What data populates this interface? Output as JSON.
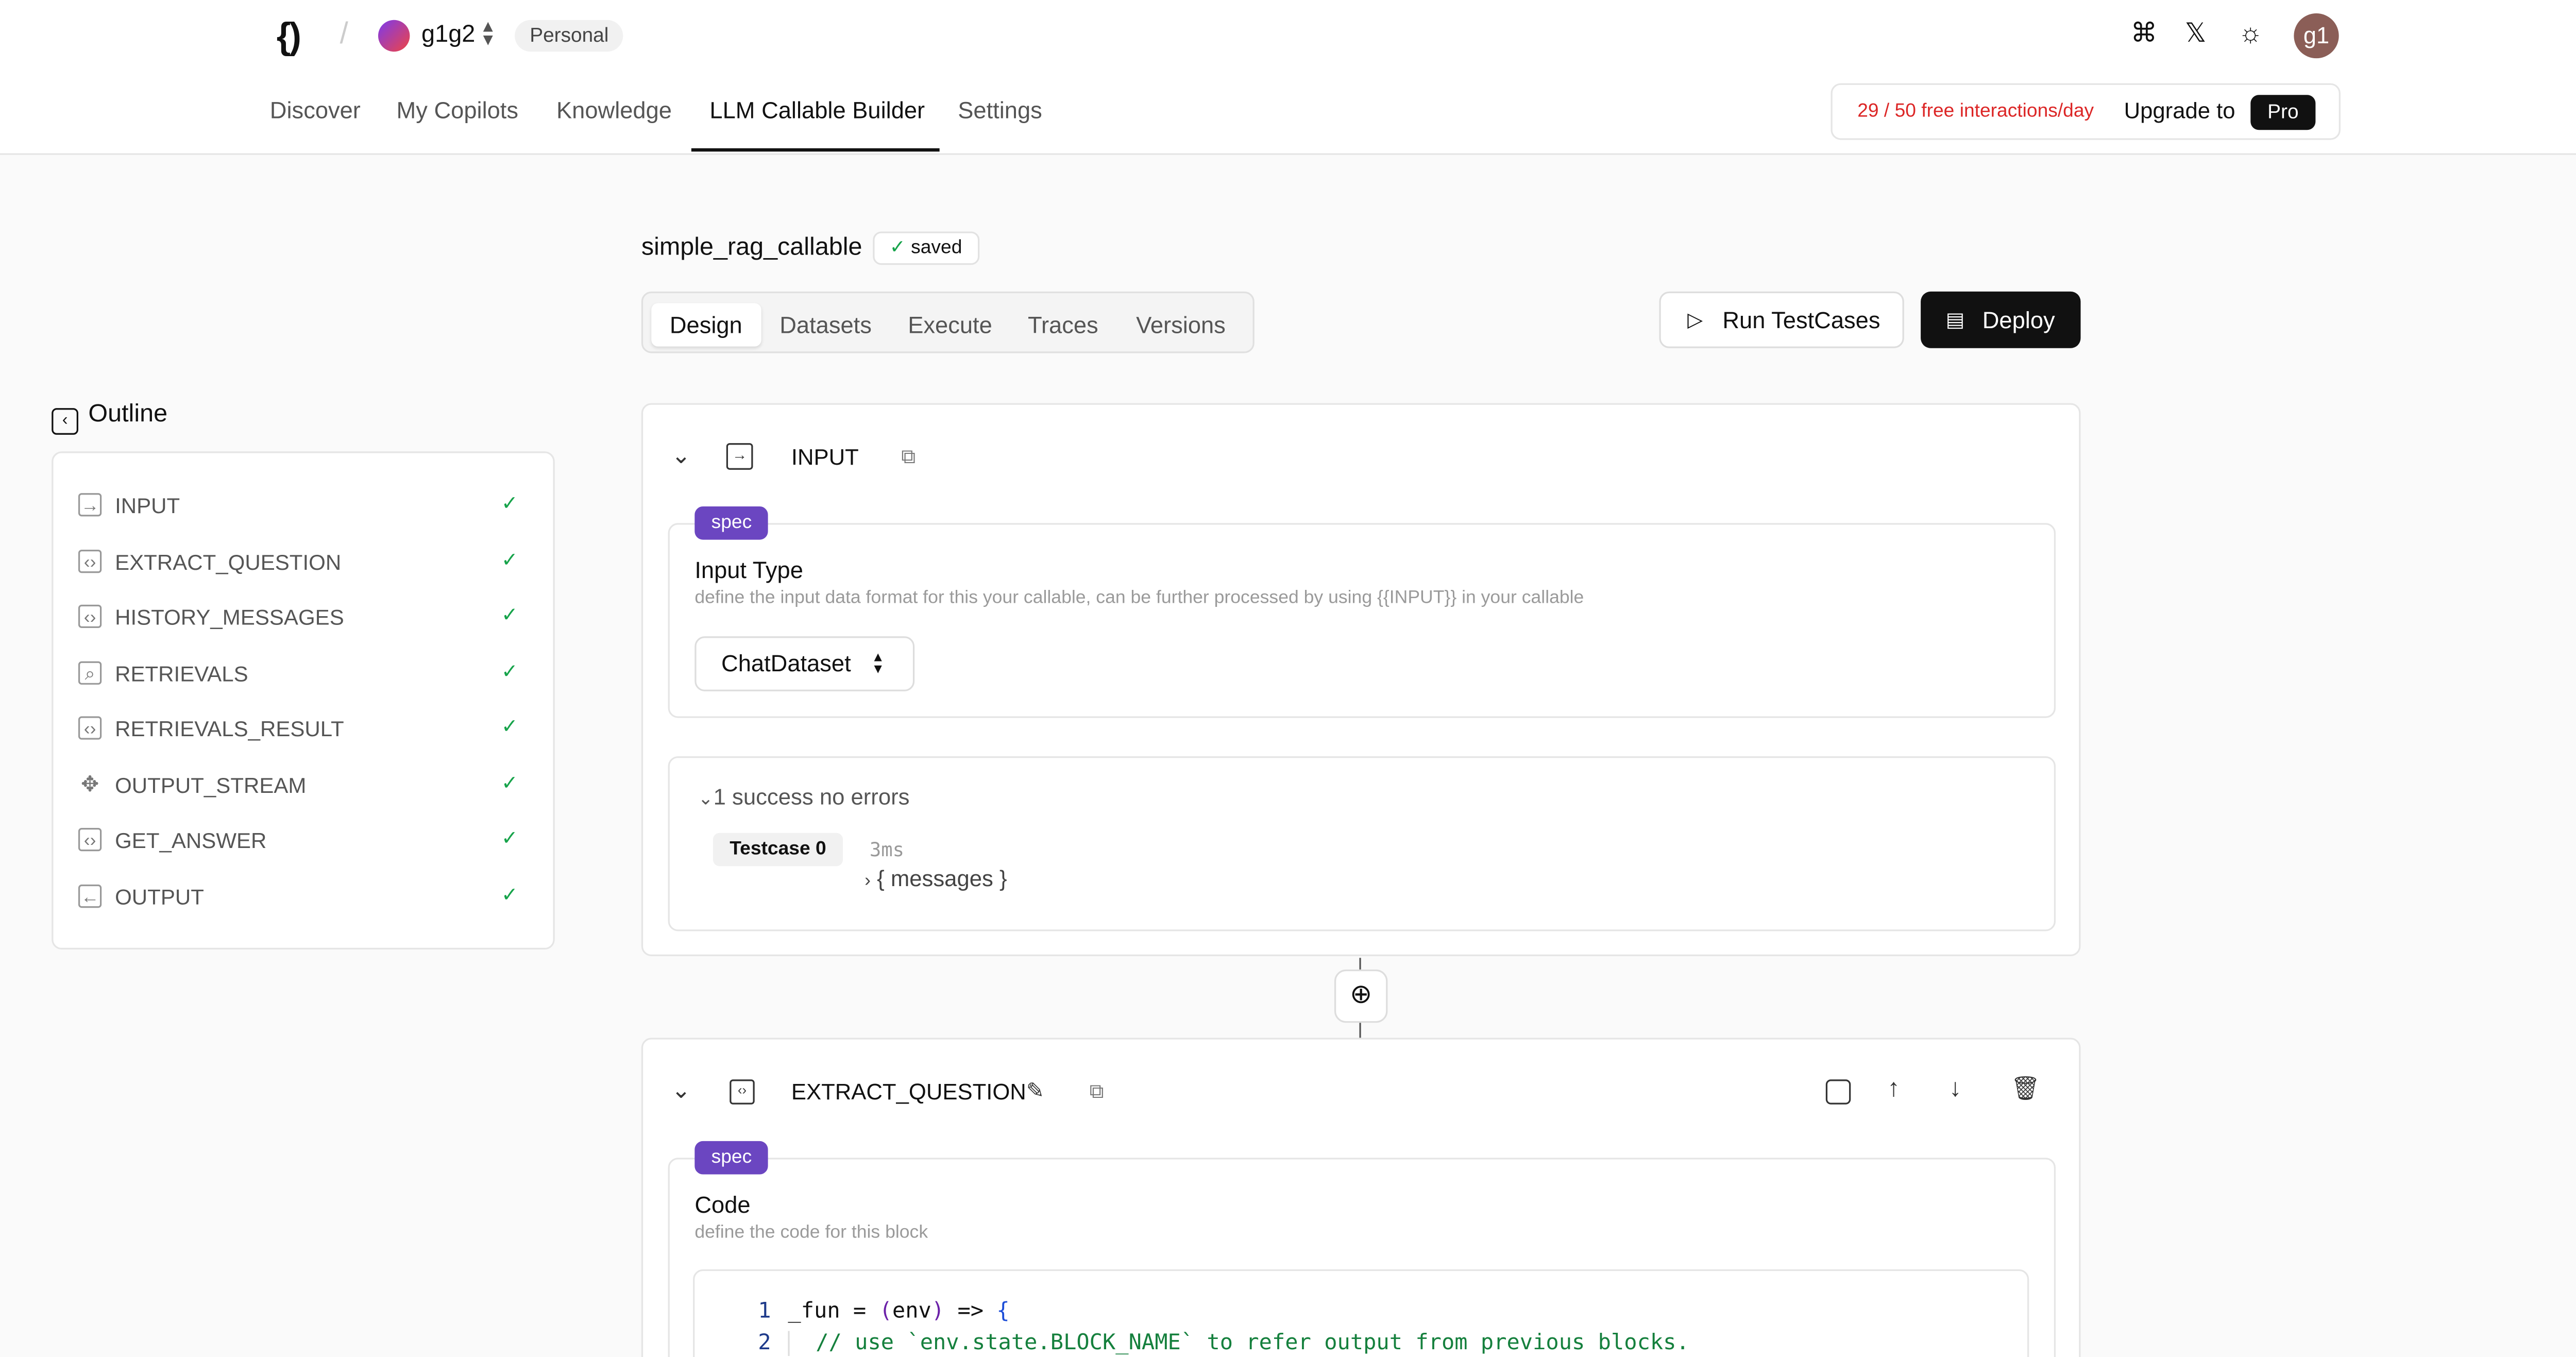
{
  "app": {
    "logo": "{)",
    "separator": "/",
    "workspace": "g1g2",
    "plan": "Personal",
    "user_initials": "g1"
  },
  "nav": {
    "items": [
      "Discover",
      "My Copilots",
      "Knowledge",
      "LLM Callable Builder",
      "Settings"
    ],
    "active": "LLM Callable Builder"
  },
  "icons": {
    "cmd": "⌘",
    "x": "𝕏",
    "theme": "☼"
  },
  "usage": {
    "text": "29 / 50 free interactions/day",
    "upgrade": "Upgrade to",
    "pro": "Pro"
  },
  "callable": {
    "name": "simple_rag_callable",
    "status": "saved"
  },
  "tabs": [
    "Design",
    "Datasets",
    "Execute",
    "Traces",
    "Versions"
  ],
  "actions": {
    "run": "Run TestCases",
    "deploy": "Deploy"
  },
  "outline": {
    "title": "Outline",
    "items": [
      "INPUT",
      "EXTRACT_QUESTION",
      "HISTORY_MESSAGES",
      "RETRIEVALS",
      "RETRIEVALS_RESULT",
      "OUTPUT_STREAM",
      "GET_ANSWER",
      "OUTPUT"
    ]
  },
  "input_block": {
    "title": "INPUT",
    "spec": "spec",
    "section_title": "Input Type",
    "section_desc": "define the input data format for this your callable, can be further processed by using {{INPUT}} in your callable",
    "input_type": "ChatDataset",
    "results_summary": "1 success no errors",
    "testcase": "Testcase 0",
    "duration": "3ms",
    "output_preview": "{ messages }"
  },
  "extract_block": {
    "title": "EXTRACT_QUESTION",
    "spec": "spec",
    "section_title": "Code",
    "section_desc": "define the code for this block",
    "code": [
      {
        "n": "1",
        "text": "_fun = (env) => {"
      },
      {
        "n": "2",
        "text": "  // use `env.state.BLOCK_NAME` to refer output from previous blocks."
      }
    ]
  }
}
